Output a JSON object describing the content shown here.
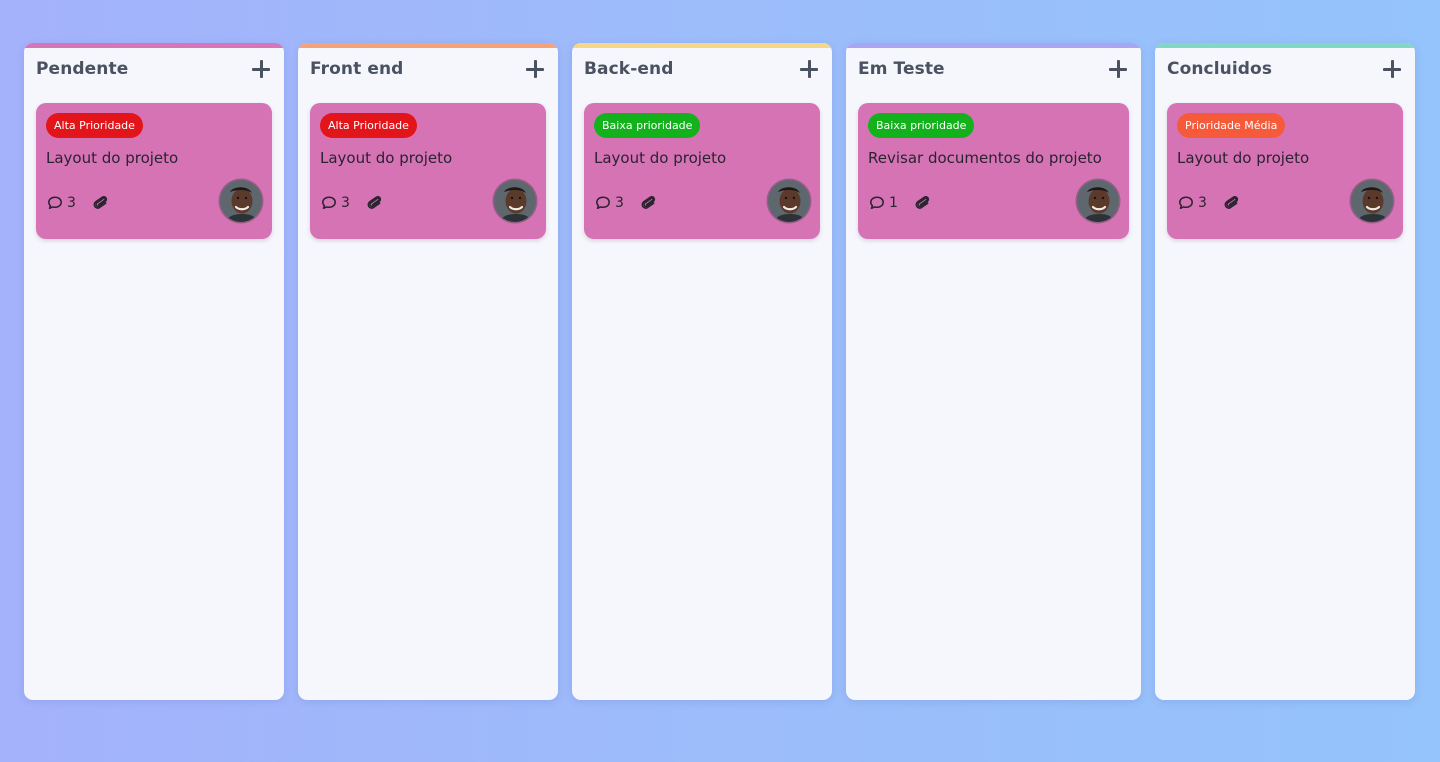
{
  "colors": {
    "card_bg": "#d673b5",
    "column_bg": "#f5f7fc",
    "high": "#e2151b",
    "low": "#13b21c",
    "medium": "#f55b3a"
  },
  "columns": [
    {
      "title": "Pendente",
      "bar_color": "#d676b8",
      "card": {
        "badge": "Alta Prioridade",
        "badge_color": "#e2151b",
        "title": "Layout do projeto",
        "comments": "3"
      }
    },
    {
      "title": "Front end",
      "bar_color": "#f5a27b",
      "card": {
        "badge": "Alta Prioridade",
        "badge_color": "#e2151b",
        "title": "Layout do projeto",
        "comments": "3"
      }
    },
    {
      "title": "Back-end",
      "bar_color": "#f6d788",
      "card": {
        "badge": "Baixa prioridade",
        "badge_color": "#13b21c",
        "title": "Layout do projeto",
        "comments": "3"
      }
    },
    {
      "title": "Em Teste",
      "bar_color": "#a8a6f2",
      "card": {
        "badge": "Baixa prioridade",
        "badge_color": "#13b21c",
        "title": "Revisar documentos do projeto",
        "comments": "1"
      }
    },
    {
      "title": "Concluidos",
      "bar_color": "#80d8c4",
      "card": {
        "badge": "Prioridade Média",
        "badge_color": "#f55b3a",
        "title": "Layout do projeto",
        "comments": "3"
      }
    }
  ]
}
